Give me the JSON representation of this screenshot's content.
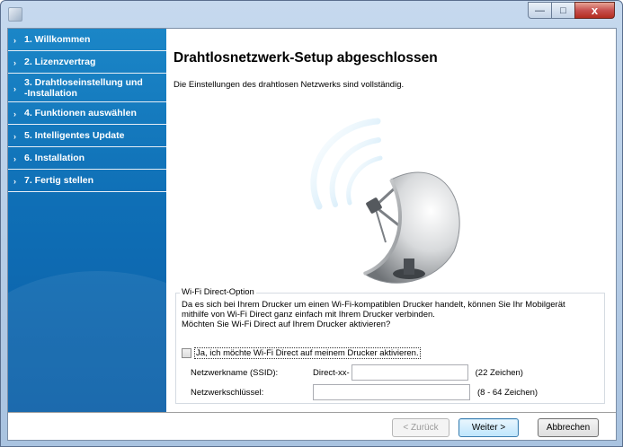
{
  "window": {
    "controls": {
      "minimize": "—",
      "maximize": "□",
      "close": "x"
    }
  },
  "sidebar": {
    "items": [
      {
        "label": "1. Willkommen"
      },
      {
        "label": "2. Lizenzvertrag"
      },
      {
        "label_line1": "3. Drahtloseinstellung und",
        "label_line2": "-Installation"
      },
      {
        "label": "4. Funktionen auswählen"
      },
      {
        "label": "5. Intelligentes Update"
      },
      {
        "label": "6. Installation"
      },
      {
        "label": "7. Fertig stellen"
      }
    ],
    "chevron": "›"
  },
  "main": {
    "title": "Drahtlosnetzwerk-Setup abgeschlossen",
    "description": "Die Einstellungen des drahtlosen Netzwerks sind vollständig.",
    "illustration_icon": "satellite-dish-icon"
  },
  "wifi_direct": {
    "legend": "Wi-Fi Direct-Option",
    "description_line1": "Da es sich bei Ihrem Drucker um einen Wi-Fi-kompatiblen Drucker handelt, können Sie Ihr Mobilgerät",
    "description_line2": "mithilfe von Wi-Fi Direct ganz einfach mit Ihrem Drucker verbinden.",
    "description_line3": "Möchten Sie Wi-Fi Direct auf Ihrem Drucker aktivieren?",
    "checkbox_label": "Ja, ich möchte Wi-Fi Direct auf meinem Drucker aktivieren.",
    "checkbox_checked": false,
    "ssid_label": "Netzwerkname (SSID):",
    "ssid_prefix": "Direct-xx-",
    "ssid_value": "",
    "ssid_hint": "(22 Zeichen)",
    "key_label": "Netzwerkschlüssel:",
    "key_value": "",
    "key_hint": "(8 - 64 Zeichen)"
  },
  "footer": {
    "back_label": "< Zurück",
    "next_label": "Weiter >",
    "cancel_label": "Abbrechen"
  },
  "colors": {
    "sidebar_top": "#1b86c7",
    "sidebar_bottom": "#0b5fa7",
    "close_button": "#c75050"
  }
}
